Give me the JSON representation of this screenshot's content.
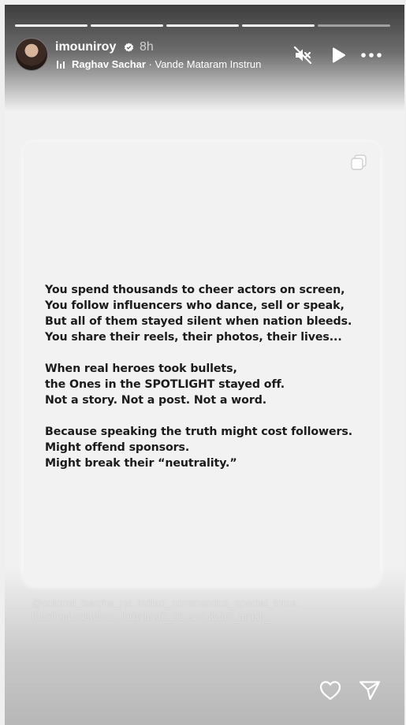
{
  "story": {
    "progress_segments": 5,
    "active_segment": 5,
    "username": "imouniroy",
    "verified": true,
    "time_ago": "8h",
    "music": {
      "artist": "Raghav Sachar",
      "separator": " · ",
      "track": "Vande Mataram Instrun"
    },
    "icons": {
      "mute": "speaker-muted-icon",
      "play": "play-icon",
      "more": "more-options-icon",
      "copy": "copy-icon",
      "like": "heart-icon",
      "share": "send-icon"
    }
  },
  "card": {
    "stanzas": [
      {
        "lines": [
          "You spend thousands to cheer actors on screen,",
          "You follow influencers who dance, sell or speak,",
          "But all of them stayed silent when nation bleeds.",
          "You share their reels, their photos, their lives..."
        ]
      },
      {
        "lines": [
          "When real heroes took bullets,",
          "the Ones in the SPOTLIGHT stayed off.",
          "Not a story. Not a post. Not a word."
        ]
      },
      {
        "lines": [
          "Because speaking the truth might cost followers.",
          "Might offend sponsors.",
          "Might break their “neutrality.”"
        ]
      }
    ]
  },
  "mentions": {
    "line1": "@colonel_barsha_rai, indian_commandos_special_force,",
    "line2_a": "thesilentexistence, ladydeath_01",
    "line2_and": " and ",
    "line2_b": "tiwari_arush_"
  }
}
